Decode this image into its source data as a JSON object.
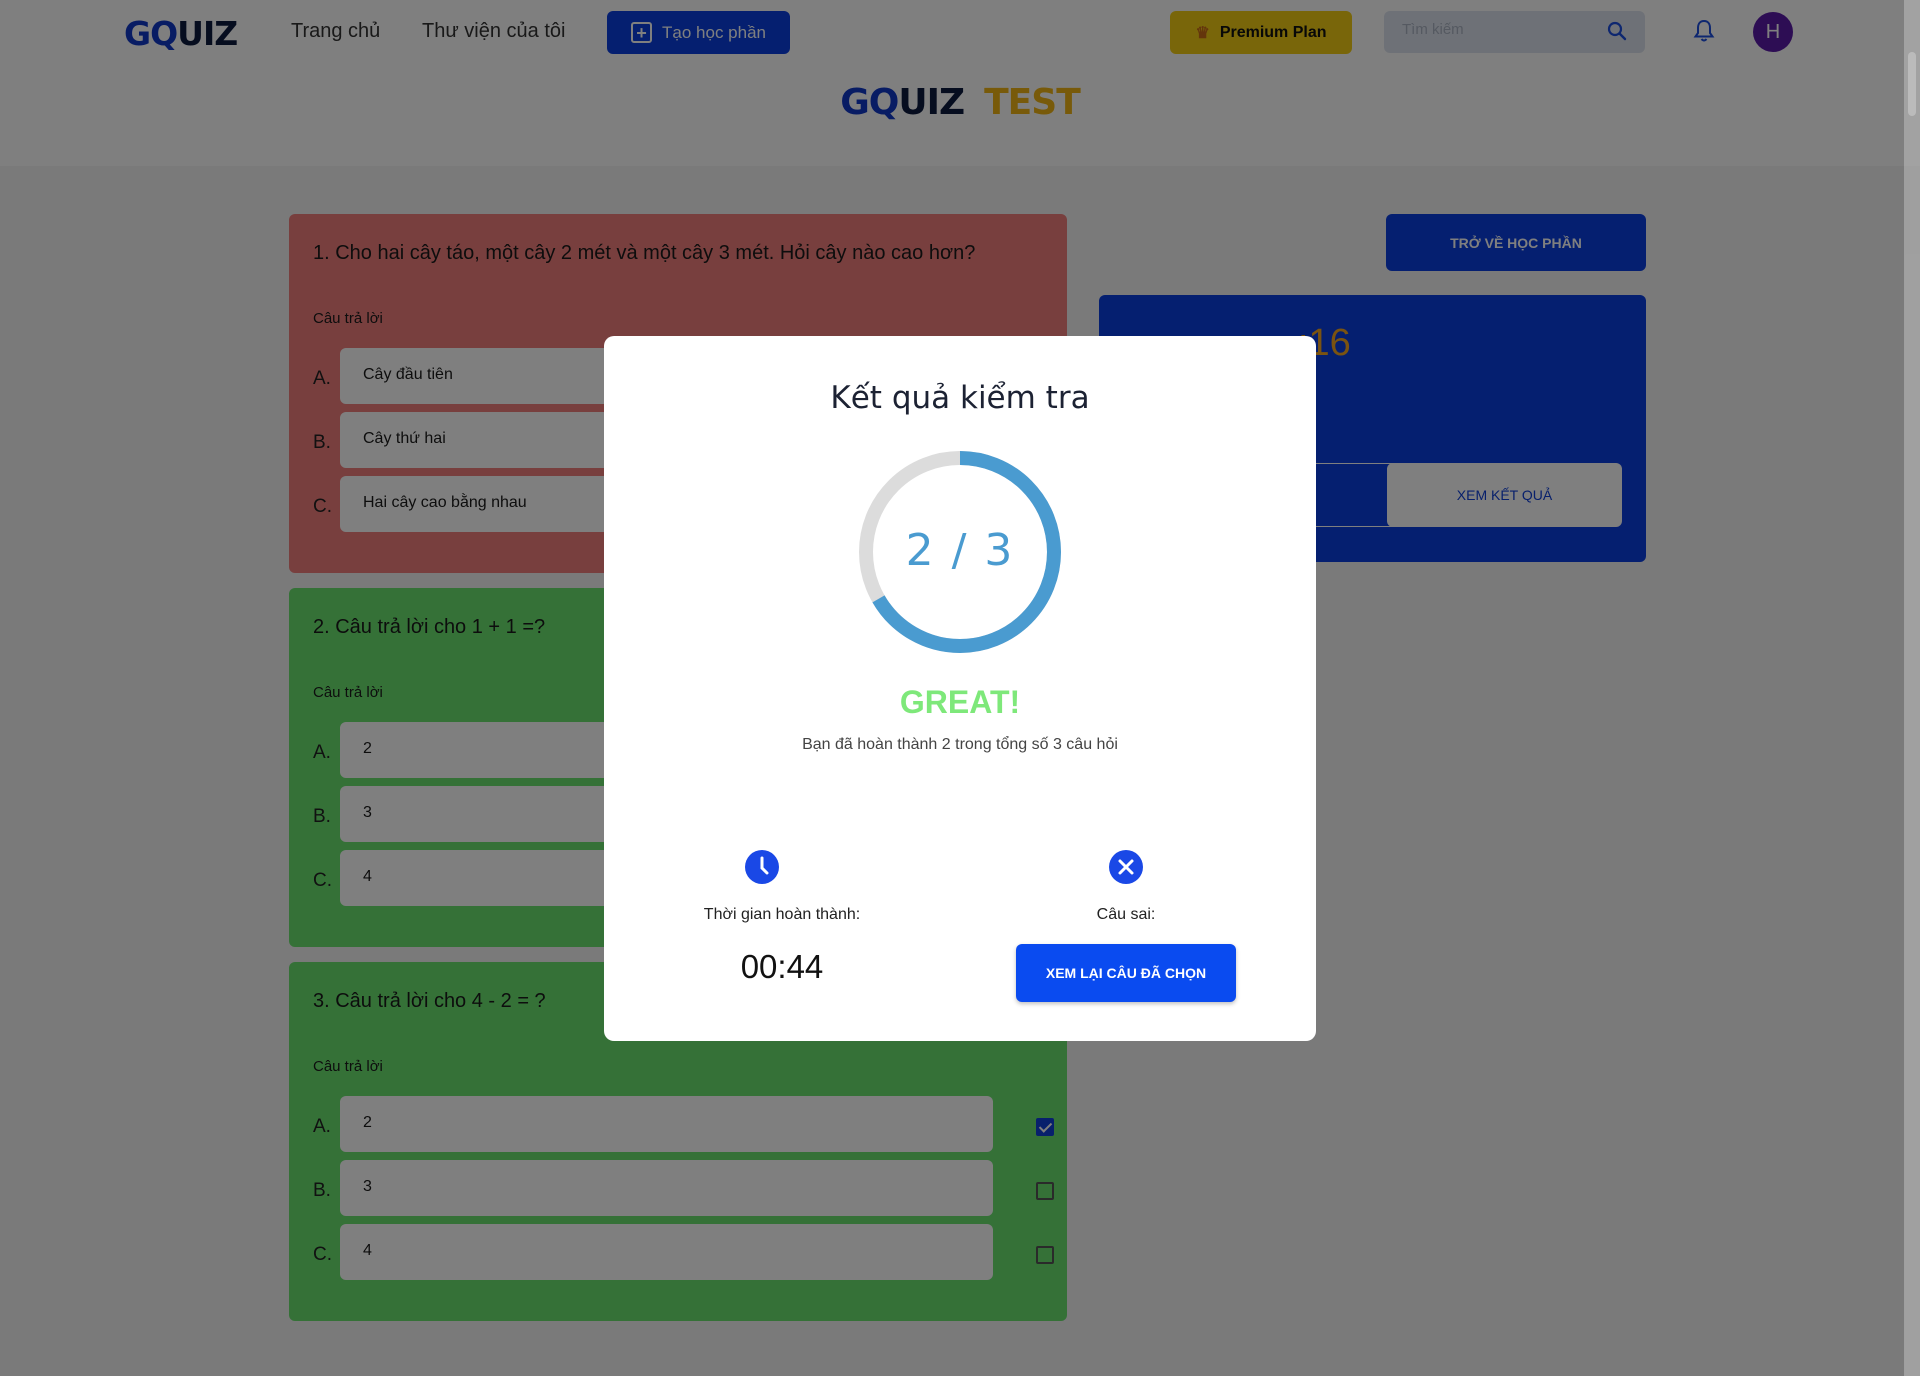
{
  "header": {
    "logo": {
      "g": "G",
      "q": "Q",
      "uiz": "UIZ"
    },
    "nav": [
      "Trang chủ",
      "Thư viện của tôi"
    ],
    "create_label": "Tạo học phần",
    "premium_label": "Premium Plan",
    "search_placeholder": "Tìm kiếm",
    "avatar_initial": "H"
  },
  "page_title": {
    "gq": "GQ",
    "uiz": "UIZ",
    "test": "TEST"
  },
  "questions": [
    {
      "text": "1. Cho hai cây táo, một cây 2 mét và một cây 3 mét. Hỏi cây nào cao hơn?",
      "answer_label": "Câu trả lời",
      "status": "wrong",
      "options": [
        {
          "letter": "A.",
          "text": "Cây đầu tiên"
        },
        {
          "letter": "B.",
          "text": "Cây thứ hai"
        },
        {
          "letter": "C.",
          "text": "Hai cây cao bằng nhau"
        }
      ]
    },
    {
      "text": "2. Câu trả lời cho 1 + 1 =?",
      "answer_label": "Câu trả lời",
      "status": "correct",
      "options": [
        {
          "letter": "A.",
          "text": "2"
        },
        {
          "letter": "B.",
          "text": "3"
        },
        {
          "letter": "C.",
          "text": "4"
        }
      ]
    },
    {
      "text": "3. Câu trả lời cho 4 - 2 = ?",
      "answer_label": "Câu trả lời",
      "status": "correct",
      "options": [
        {
          "letter": "A.",
          "text": "2",
          "checked": true
        },
        {
          "letter": "B.",
          "text": "3",
          "checked": false
        },
        {
          "letter": "C.",
          "text": "4",
          "checked": false
        }
      ]
    }
  ],
  "side": {
    "back_label": "TRỞ VỀ HỌC PHẦN",
    "timer_visible": ":16",
    "result_label": "XEM KẾT QUẢ"
  },
  "modal": {
    "title": "Kết quả kiểm tra",
    "score_text": "2 / 3",
    "score_correct": 2,
    "score_total": 3,
    "verdict": "GREAT!",
    "summary": "Bạn đã hoàn thành 2 trong tổng số 3 câu hỏi",
    "time_label": "Thời gian hoàn thành:",
    "time_value": "00:44",
    "wrong_label": "Câu sai:",
    "review_label": "XEM LẠI CÂU ĐÃ CHỌN"
  },
  "colors": {
    "primary": "#0a3fe0",
    "wrong_card": "#f07e7c",
    "correct_card": "#6ae36f",
    "accent_yellow": "#f2cc14",
    "ring": "#4a9bd0",
    "great": "#7ee87a"
  }
}
